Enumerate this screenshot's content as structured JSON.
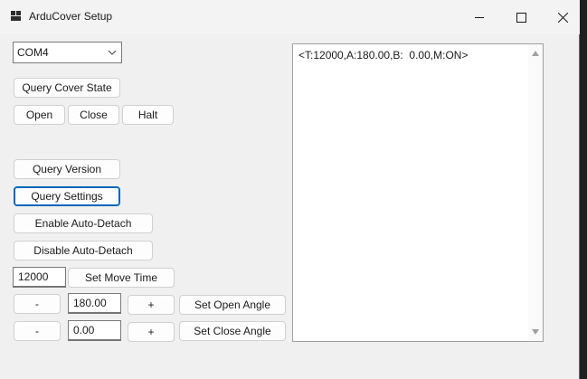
{
  "window": {
    "title": "ArduCover Setup"
  },
  "titlebar": {
    "minimize_icon": "minimize-icon",
    "maximize_icon": "maximize-icon",
    "close_icon": "close-icon"
  },
  "port": {
    "selected": "COM4"
  },
  "buttons": {
    "query_cover_state": "Query Cover State",
    "open": "Open",
    "close": "Close",
    "halt": "Halt",
    "query_version": "Query Version",
    "query_settings": "Query Settings",
    "enable_auto_detach": "Enable Auto-Detach",
    "disable_auto_detach": "Disable Auto-Detach",
    "set_move_time": "Set Move Time",
    "open_minus": "-",
    "open_plus": "+",
    "set_open_angle": "Set Open Angle",
    "close_minus": "-",
    "close_plus": "+",
    "set_close_angle": "Set Close Angle"
  },
  "fields": {
    "move_time": "12000",
    "open_angle": "180.00",
    "close_angle": "0.00"
  },
  "output": {
    "text": "<T:12000,A:180.00,B:  0.00,M:ON>"
  },
  "colors": {
    "accent": "#0067c0",
    "window_bg": "#f0f0f0"
  }
}
